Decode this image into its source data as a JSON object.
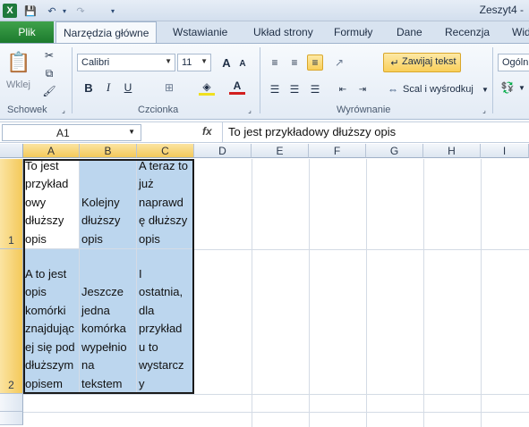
{
  "window": {
    "title": "Zeszyt4 -"
  },
  "qat": {
    "logo": "X",
    "save": "💾",
    "undo": "↶",
    "undo_arrow": "▾",
    "redo": "↷",
    "customize": "▾"
  },
  "tabs": {
    "file": "Plik",
    "items": [
      "Narzędzia główne",
      "Wstawianie",
      "Układ strony",
      "Formuły",
      "Dane",
      "Recenzja",
      "Wid"
    ]
  },
  "ribbon": {
    "clipboard": {
      "paste": "Wklej",
      "label": "Schowek"
    },
    "font": {
      "name": "Calibri",
      "size": "11",
      "grow": "A",
      "shrink": "A",
      "bold": "B",
      "italic": "I",
      "underline": "U",
      "fill_color": "◈",
      "font_color": "A",
      "label": "Czcionka"
    },
    "alignment": {
      "wrap": "Zawijaj tekst",
      "merge": "Scal i wyśrodkuj",
      "label": "Wyrównanie"
    },
    "number": {
      "format": "Ogóln"
    }
  },
  "formula_bar": {
    "name_box": "A1",
    "fx": "fx",
    "content": "To jest przykładowy dłuższy opis"
  },
  "sheet": {
    "columns": [
      "A",
      "B",
      "C",
      "D",
      "E",
      "F",
      "G",
      "H",
      "I"
    ],
    "rows": [
      "1",
      "2"
    ],
    "cells": {
      "A1": [
        "To jest",
        "przykład",
        "owy",
        "dłuższy",
        "opis"
      ],
      "B1": [
        "Kolejny",
        "dłuższy",
        "opis"
      ],
      "C1": [
        "A teraz to",
        "już",
        "naprawd",
        "ę dłuższy",
        "opis"
      ],
      "A2": [
        "A to jest",
        "opis",
        "komórki",
        "znajdując",
        "ej się pod",
        "dłuższym",
        "opisem"
      ],
      "B2": [
        "Jeszcze",
        "jedna",
        "komórka",
        "wypełnio",
        "na",
        "tekstem"
      ],
      "C2": [
        "I",
        "ostatnia,",
        "dla",
        "przykład",
        "u to",
        "wystarcz",
        "y"
      ]
    }
  },
  "colors": {
    "accent": "#1c7a2d",
    "selection": "#bcd6ee",
    "header_selected": "#f4c95a"
  }
}
